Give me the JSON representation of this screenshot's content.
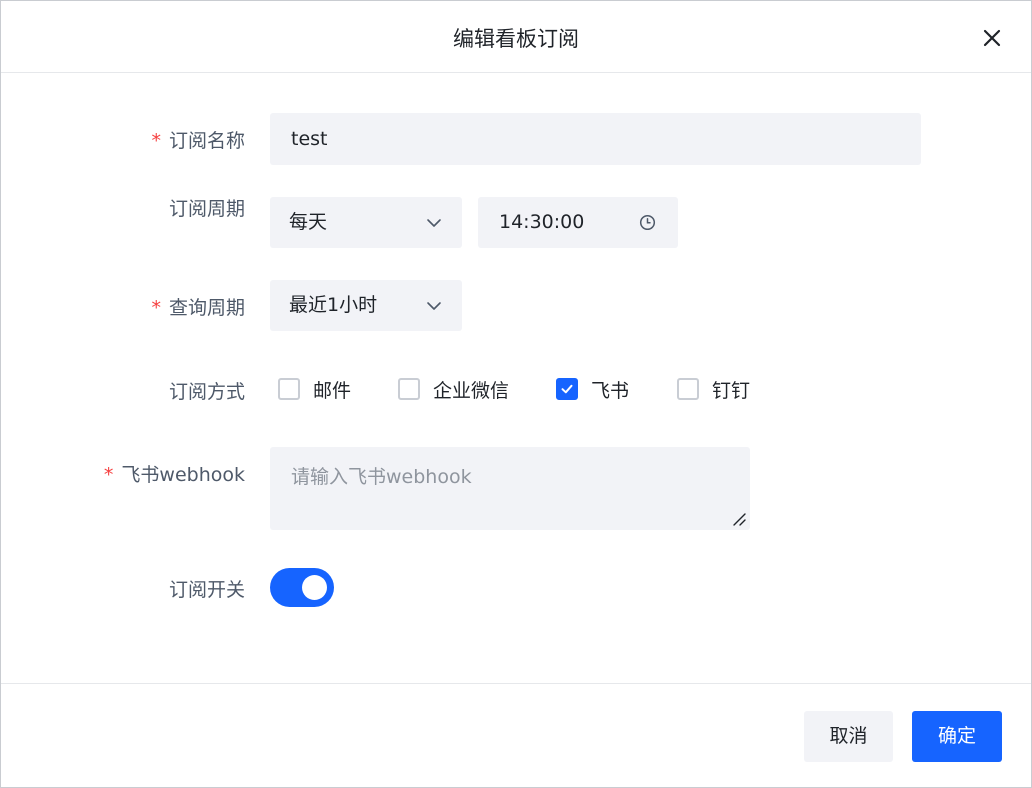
{
  "dialog": {
    "title": "编辑看板订阅"
  },
  "form": {
    "name": {
      "label": "订阅名称",
      "required": "*",
      "value": "test"
    },
    "cycle": {
      "label": "订阅周期",
      "frequency": "每天",
      "time": "14:30:00"
    },
    "query_period": {
      "label": "查询周期",
      "required": "*",
      "value": "最近1小时"
    },
    "method": {
      "label": "订阅方式",
      "options": [
        {
          "label": "邮件",
          "checked": false
        },
        {
          "label": "企业微信",
          "checked": false
        },
        {
          "label": "飞书",
          "checked": true
        },
        {
          "label": "钉钉",
          "checked": false
        }
      ]
    },
    "webhook": {
      "label": "飞书webhook",
      "required": "*",
      "placeholder": "请输入飞书webhook",
      "value": ""
    },
    "switch": {
      "label": "订阅开关",
      "on": true
    }
  },
  "footer": {
    "cancel_label": "取消",
    "ok_label": "确定"
  },
  "colors": {
    "accent": "#1664ff",
    "required": "#f53f3f",
    "field_bg": "#f2f3f7"
  }
}
